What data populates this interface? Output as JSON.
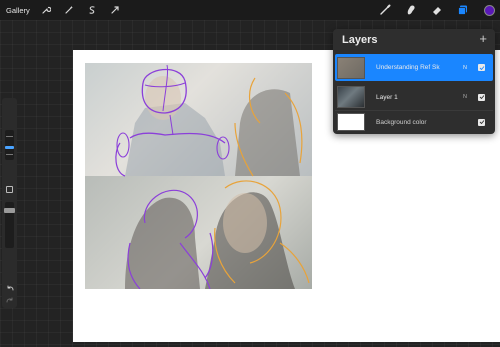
{
  "toolbar": {
    "gallery_label": "Gallery",
    "left_tools": [
      "wrench-icon",
      "magic-wand-icon",
      "selection-icon",
      "transform-arrow-icon"
    ],
    "right_tools": [
      "brush-icon",
      "smudge-icon",
      "eraser-icon",
      "layers-icon",
      "color-swatch"
    ],
    "active_color": "#5a18b8",
    "accent": "#1a86ff"
  },
  "layers_panel": {
    "title": "Layers",
    "add_label": "+",
    "layers": [
      {
        "name": "Understanding Ref Sk",
        "blend": "N",
        "visible": true,
        "selected": true
      },
      {
        "name": "Layer 1",
        "blend": "N",
        "visible": true,
        "selected": false
      },
      {
        "name": "Background color",
        "blend": "",
        "visible": true,
        "selected": false
      }
    ]
  },
  "sidebar": {
    "controls": [
      "brush-size-slider",
      "modify-button",
      "opacity-slider",
      "undo-icon",
      "redo-icon"
    ]
  }
}
